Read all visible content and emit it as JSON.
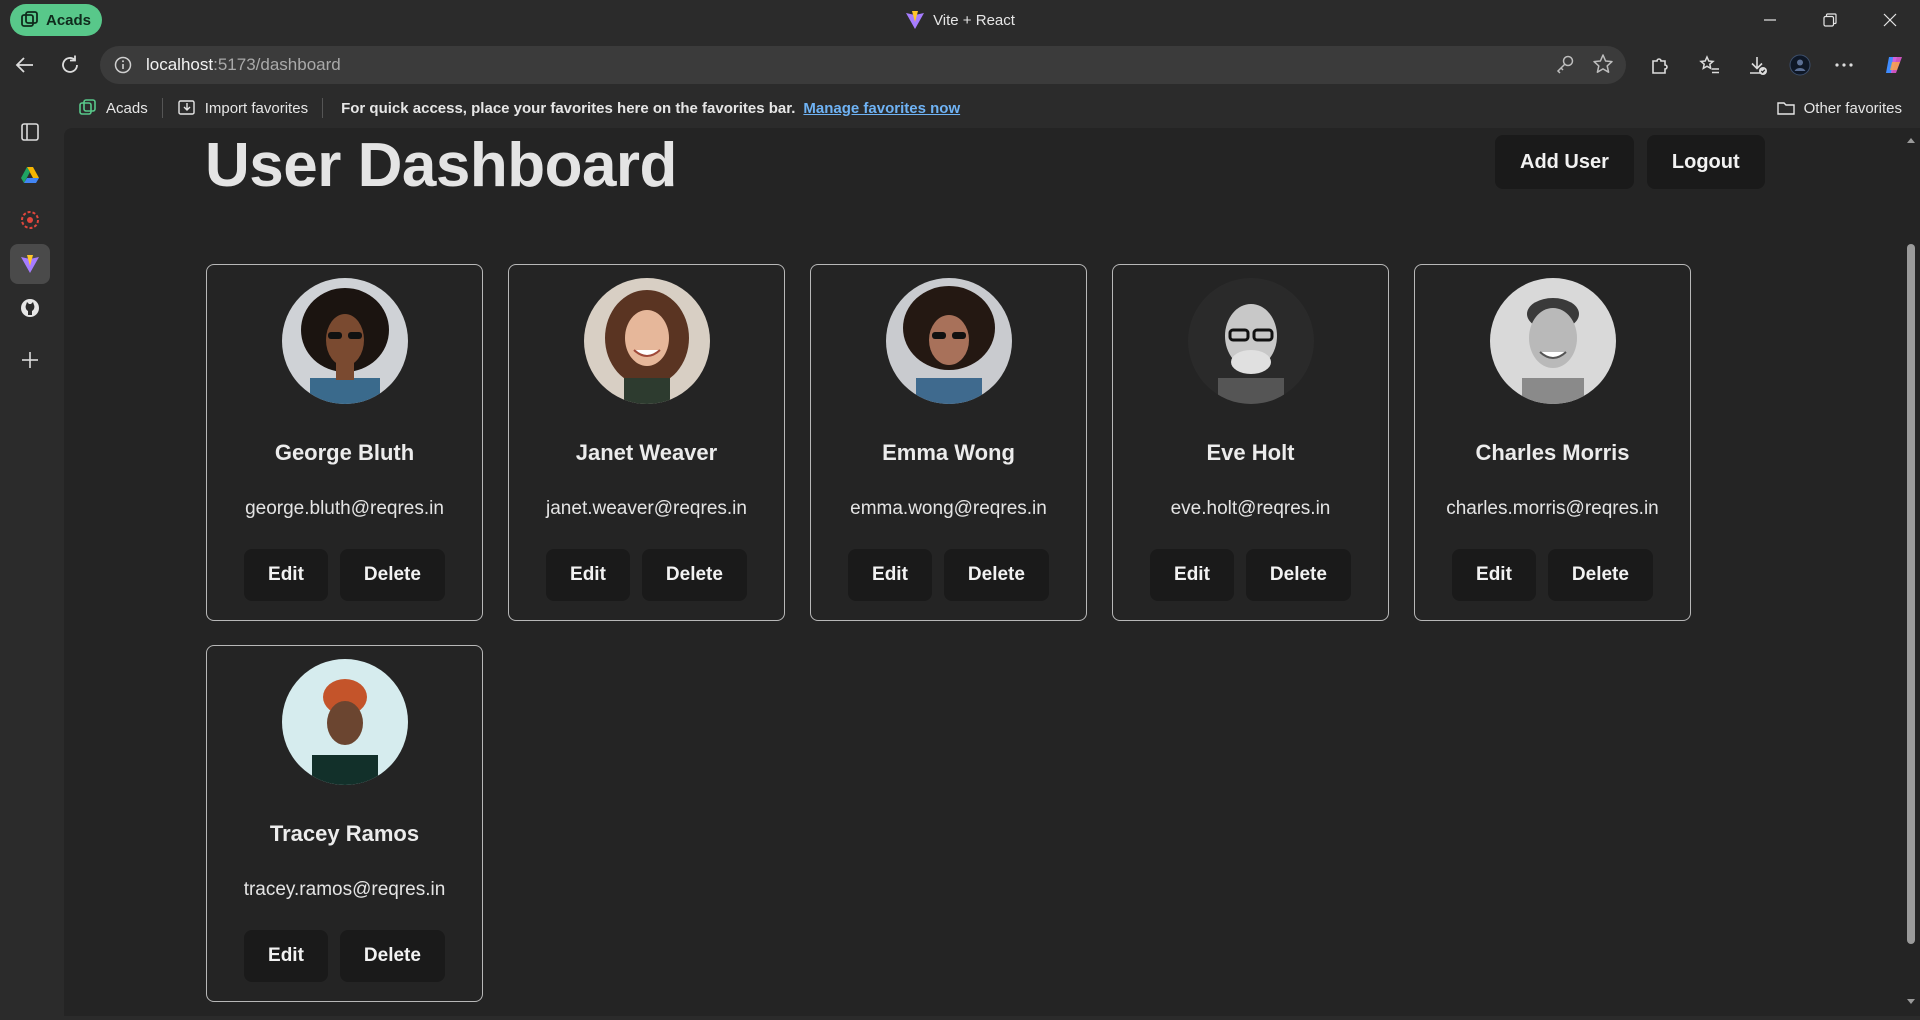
{
  "browser": {
    "profile_label": "Acads",
    "window_title": "Vite + React",
    "url_host": "localhost",
    "url_path": ":5173/dashboard",
    "favorites": {
      "acads": "Acads",
      "import": "Import favorites",
      "hint": "For quick access, place your favorites here on the favorites bar.",
      "manage_link": "Manage favorites now",
      "other": "Other favorites"
    },
    "accent_profile": "#58c88a",
    "link_color": "#6fb3f5"
  },
  "page": {
    "title": "User Dashboard",
    "add_user_label": "Add User",
    "logout_label": "Logout"
  },
  "users": [
    {
      "name": "George Bluth",
      "email": "george.bluth@reqres.in",
      "edit": "Edit",
      "delete": "Delete"
    },
    {
      "name": "Janet Weaver",
      "email": "janet.weaver@reqres.in",
      "edit": "Edit",
      "delete": "Delete"
    },
    {
      "name": "Emma Wong",
      "email": "emma.wong@reqres.in",
      "edit": "Edit",
      "delete": "Delete"
    },
    {
      "name": "Eve Holt",
      "email": "eve.holt@reqres.in",
      "edit": "Edit",
      "delete": "Delete"
    },
    {
      "name": "Charles Morris",
      "email": "charles.morris@reqres.in",
      "edit": "Edit",
      "delete": "Delete"
    },
    {
      "name": "Tracey Ramos",
      "email": "tracey.ramos@reqres.in",
      "edit": "Edit",
      "delete": "Delete"
    }
  ]
}
